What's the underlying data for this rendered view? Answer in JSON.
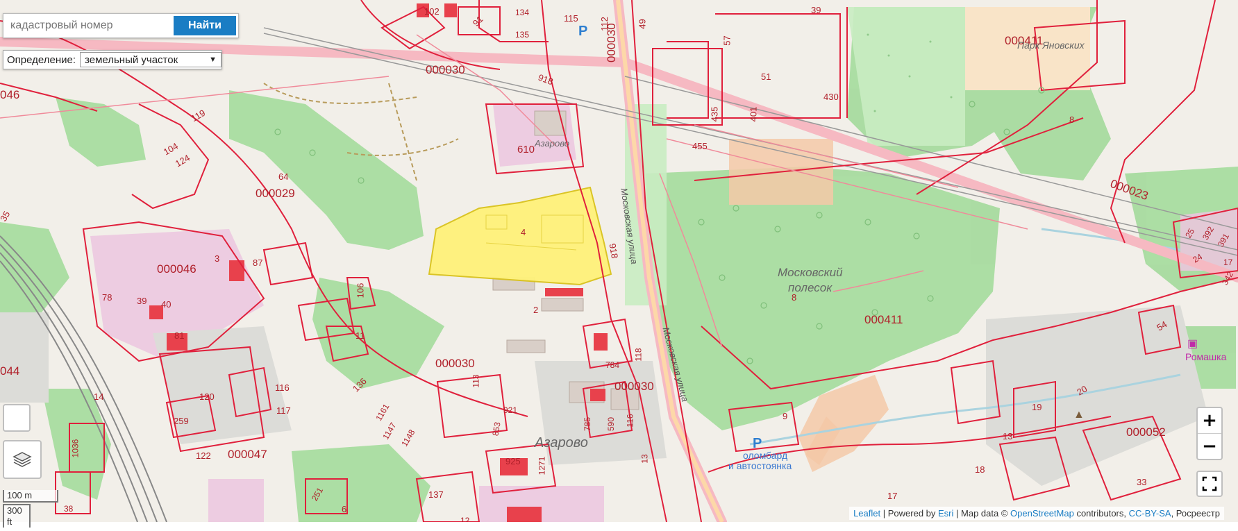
{
  "search": {
    "placeholder": "кадастровый номер",
    "button": "Найти"
  },
  "definition": {
    "label": "Определение:",
    "value": "земельный участок"
  },
  "zoom": {
    "in": "+",
    "out": "−"
  },
  "scale": {
    "metric": "100 m",
    "imperial": "300 ft"
  },
  "attribution": {
    "leaflet": "Leaflet",
    "powered": "| Powered by",
    "esri": "Esri",
    "mapdata": "| Map data ©",
    "osm": "OpenStreetMap",
    "contrib": "contributors,",
    "license": "CC-BY-SA",
    "rosreestr": ", Росреестр"
  },
  "map_labels": {
    "park_name": "Парк Яновских",
    "moscow_forest_1": "Московский",
    "moscow_forest_2": "полесок",
    "azarovo_village": "Азарово",
    "azarovo_small": "Азарово",
    "romashka": "Ромашка",
    "bus_stop_1": "оломбард",
    "bus_stop_2": "и автостоянка",
    "street_moscow": "Московская улица",
    "q_000411_top": "000411",
    "q_000411_mid": "000411",
    "q_000030_a": "000030",
    "q_000030_b": "000030",
    "q_000030_c": "000030",
    "q_000030_d": "000030",
    "q_000029": "000029",
    "q_000046_a": "000046",
    "q_000046_b": "046",
    "q_000047": "000047",
    "q_000052": "000052",
    "q_000023": "000023",
    "q_044": "044",
    "n_4": "4",
    "n_8a": "8",
    "n_8b": "8",
    "n_610": "610",
    "n_918a": "918",
    "n_918b": "918",
    "n_455": "455",
    "n_430": "430",
    "n_435": "435",
    "n_401": "401",
    "n_51": "51",
    "n_57": "57",
    "n_39": "39",
    "n_115": "115",
    "n_112": "112",
    "n_49": "49",
    "n_102": "102",
    "n_91": "91",
    "n_134": "134",
    "n_135": "135",
    "n_106": "106",
    "n_11": "11",
    "n_136": "136",
    "n_1161": "1161",
    "n_1147": "1147",
    "n_1148": "1148",
    "n_113": "113",
    "n_921": "921",
    "n_853": "853",
    "n_925": "925",
    "n_1271": "1271",
    "n_137": "137",
    "n_784": "784",
    "n_118": "118",
    "n_785": "785",
    "n_590": "590",
    "n_116": "116",
    "n_13": "13",
    "n_2": "2",
    "n_119": "119",
    "n_104": "104",
    "n_124": "124",
    "n_64": "64",
    "n_87": "87",
    "n_3": "3",
    "n_78": "78",
    "n_39b": "39",
    "n_40": "40",
    "n_81": "81",
    "n_120": "120",
    "n_259": "259",
    "n_122": "122",
    "n_1036": "1036",
    "n_251": "251",
    "n_116b": "116",
    "n_117": "117",
    "n_14": "14",
    "n_38": "38",
    "n_6": "6",
    "n_12": "12",
    "n_54": "54",
    "n_20": "20",
    "n_19": "19",
    "n_13b": "13",
    "n_18": "18",
    "n_33": "33",
    "n_17": "17",
    "n_9": "9",
    "n_35": "35",
    "n_25": "25",
    "n_392": "392",
    "n_391": "391",
    "n_24": "24",
    "n_342": "342",
    "n_17b": "17"
  },
  "colors": {
    "background": "#f2efe9",
    "forest": "#a8dca0",
    "parcel_line": "#e0203c",
    "selected_parcel": "#fff27a",
    "accent_blue": "#1a7dc4"
  }
}
